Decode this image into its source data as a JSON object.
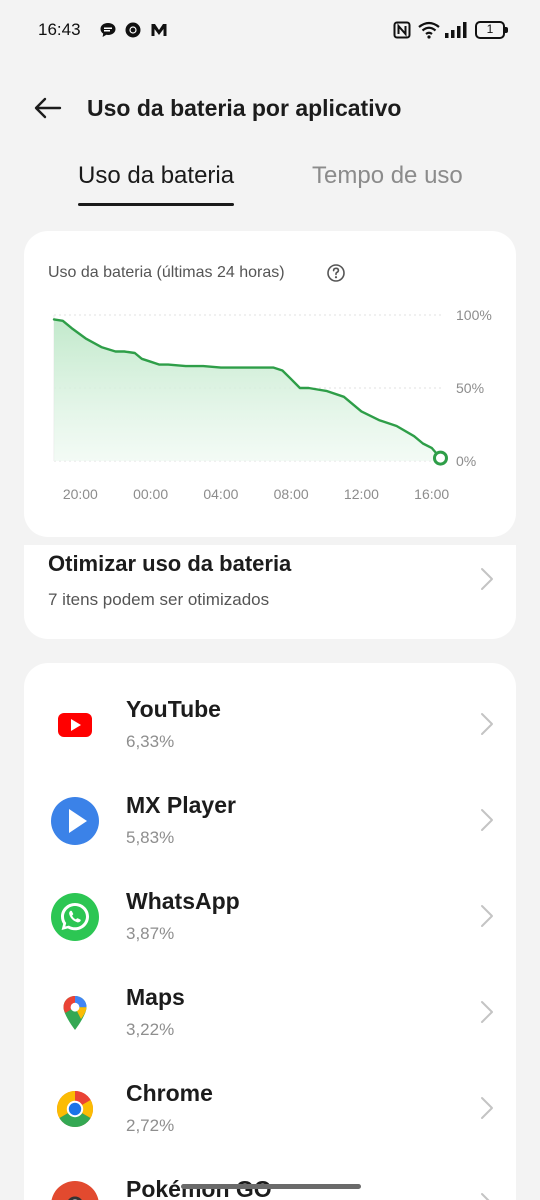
{
  "status_bar": {
    "time": "16:43",
    "battery_level": "1",
    "left_icons": [
      "chat-bubble-icon",
      "chrome-icon",
      "m-app-icon"
    ],
    "right_icons": [
      "nfc-icon",
      "wifi-icon",
      "signal-icon",
      "battery-icon"
    ]
  },
  "header": {
    "title": "Uso da bateria por aplicativo",
    "back_icon": "arrow-left-icon"
  },
  "tabs": [
    {
      "label": "Uso da bateria",
      "active": true
    },
    {
      "label": "Tempo de uso",
      "active": false
    }
  ],
  "chart": {
    "title": "Uso da bateria (últimas 24 horas)",
    "help_icon": "question-circle-icon",
    "line_color": "#2e9e48",
    "fill_color": "#d8f2df"
  },
  "chart_data": {
    "type": "area",
    "title": "Uso da bateria (últimas 24 horas)",
    "xlabel": "",
    "ylabel": "",
    "x_ticks": [
      "20:00",
      "00:00",
      "04:00",
      "08:00",
      "12:00",
      "16:00"
    ],
    "y_ticks": [
      "100%",
      "50%",
      "0%"
    ],
    "ylim": [
      0,
      100
    ],
    "xlim_hours": [
      -5.5,
      16.7
    ],
    "grid": true,
    "series": [
      {
        "x": [
          -5.5,
          -5.0,
          -4.5,
          -3.7,
          -2.8,
          -2.0,
          -1.5,
          -0.9,
          -0.5,
          0.0,
          0.5,
          1.0,
          2.0,
          3.0,
          4.0,
          5.0,
          6.0,
          7.0,
          7.5,
          8.0,
          8.5,
          9.0,
          9.5,
          10.0,
          11.0,
          12.0,
          13.0,
          14.0,
          15.0,
          15.5,
          16.0,
          16.5
        ],
        "y": [
          97,
          96,
          91,
          84,
          78,
          75,
          75,
          74,
          70,
          68,
          66,
          66,
          65,
          65,
          64,
          64,
          64,
          64,
          62,
          56,
          50,
          50,
          49,
          48,
          44,
          34,
          28,
          24,
          17,
          12,
          9,
          2
        ]
      }
    ]
  },
  "optimize": {
    "title": "Otimizar uso da bateria",
    "subtitle": "7 itens podem ser otimizados"
  },
  "apps": [
    {
      "name": "YouTube",
      "percent": "6,33%",
      "icon": "youtube-icon"
    },
    {
      "name": "MX Player",
      "percent": "5,83%",
      "icon": "mx-player-icon"
    },
    {
      "name": "WhatsApp",
      "percent": "3,87%",
      "icon": "whatsapp-icon"
    },
    {
      "name": "Maps",
      "percent": "3,22%",
      "icon": "maps-icon"
    },
    {
      "name": "Chrome",
      "percent": "2,72%",
      "icon": "chrome-icon"
    },
    {
      "name": "Pokémon GO",
      "percent": "",
      "icon": "pokemon-go-icon"
    }
  ]
}
